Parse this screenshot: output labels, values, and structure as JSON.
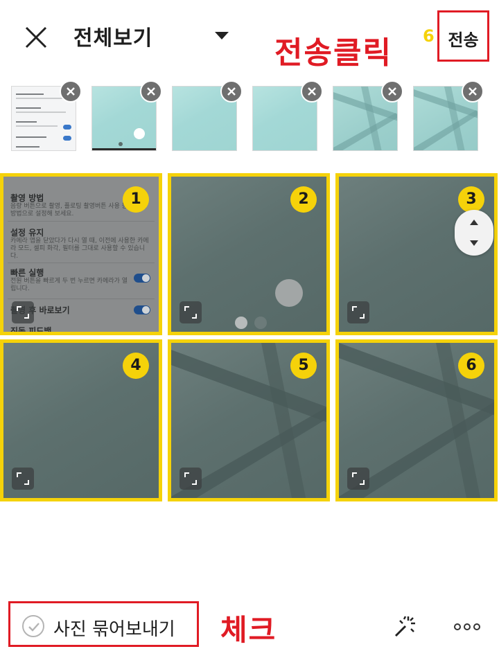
{
  "header": {
    "close_icon": "close-icon",
    "title": "전체보기",
    "dropdown_icon": "chevron-down-icon",
    "annotation": "전송클릭",
    "selected_count": "6",
    "send_label": "전송"
  },
  "selected_strip": {
    "remove_icon": "close-icon",
    "items": [
      {
        "kind": "screenshot"
      },
      {
        "kind": "floor-dot"
      },
      {
        "kind": "floor"
      },
      {
        "kind": "floor"
      },
      {
        "kind": "floor-stripes"
      },
      {
        "kind": "floor-stripes"
      }
    ]
  },
  "grid": {
    "items": [
      {
        "number": "1",
        "kind": "screenshot"
      },
      {
        "number": "2",
        "kind": "floor-dot"
      },
      {
        "number": "3",
        "kind": "floor"
      },
      {
        "number": "4",
        "kind": "floor"
      },
      {
        "number": "5",
        "kind": "floor-stripes"
      },
      {
        "number": "6",
        "kind": "floor-stripes"
      }
    ],
    "expand_icon": "expand-icon",
    "screenshot_text": {
      "item1_title": "촬영 방법",
      "item1_desc": "음량 버튼으로 촬영, 플로팅 촬영버튼 사용 등 다양한 방법으로 설정해 보세요.",
      "item2_title": "설정 유지",
      "item2_desc": "카메라 앱을 닫았다가 다시 열 때, 이전에 사용한 카메라 모드, 셀피 화각, 필터를 그대로 사용할 수 있습니다.",
      "item3_title": "빠른 실행",
      "item3_desc": "전원 버튼을 빠르게 두 번 누르면 카메라가 열립니다.",
      "item4_title": "촬영 후 바로보기",
      "item5_title": "진동 피드백"
    }
  },
  "scroll_handle": {
    "icon": "scroll-updown-icon"
  },
  "bottom_bar": {
    "bundle_label": "사진 묶어보내기",
    "bundle_checked": false,
    "annotation": "체크",
    "magic_icon": "sparkle-icon",
    "more_icon": "more-icon"
  },
  "colors": {
    "accent_yellow": "#f5d20a",
    "annotation_red": "#e01b24"
  }
}
